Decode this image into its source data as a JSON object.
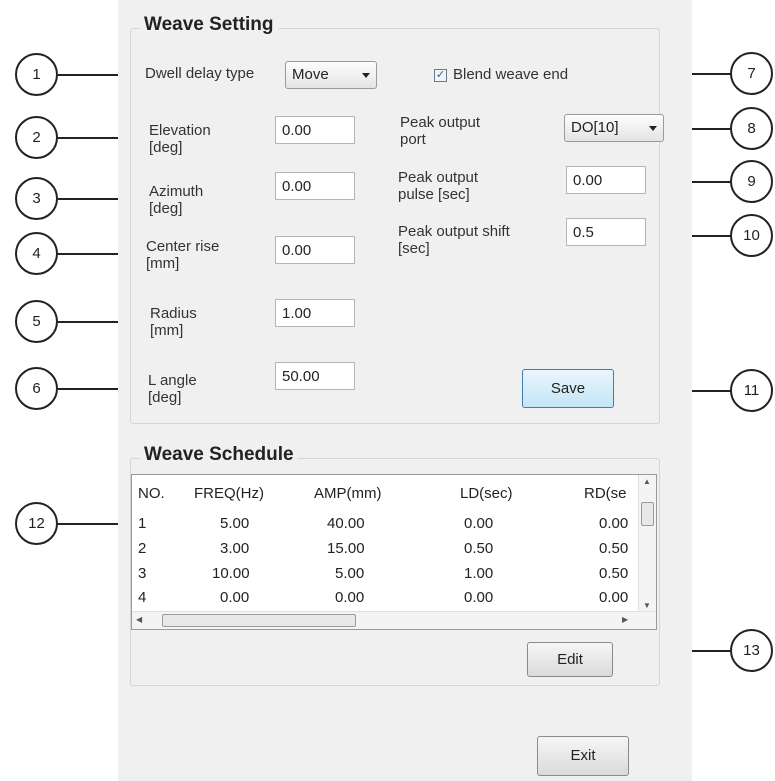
{
  "weave_setting": {
    "title": "Weave Setting",
    "dwell_delay_type": {
      "label": "Dwell delay type",
      "value": "Move"
    },
    "elevation": {
      "label": "Elevation [deg]",
      "value": "0.00"
    },
    "azimuth": {
      "label": "Azimuth [deg]",
      "value": "0.00"
    },
    "center_rise": {
      "label": "Center rise [mm]",
      "value": "0.00"
    },
    "radius": {
      "label": "Radius [mm]",
      "value": "1.00"
    },
    "l_angle": {
      "label": "L angle [deg]",
      "value": "50.00"
    },
    "blend_weave_end": {
      "label": "Blend weave end",
      "checked": true
    },
    "peak_output_port": {
      "label": "Peak output port",
      "value": "DO[10]"
    },
    "peak_output_pulse": {
      "label": "Peak output pulse [sec]",
      "value": "0.00"
    },
    "peak_output_shift": {
      "label": "Peak output shift [sec]",
      "value": "0.5"
    },
    "save_label": "Save"
  },
  "weave_schedule": {
    "title": "Weave Schedule",
    "columns": [
      "NO.",
      "FREQ(Hz)",
      "AMP(mm)",
      "LD(sec)",
      "RD(se"
    ],
    "rows": [
      [
        "1",
        "5.00",
        "40.00",
        "0.00",
        "0.00"
      ],
      [
        "2",
        "3.00",
        "15.00",
        "0.50",
        "0.50"
      ],
      [
        "3",
        "10.00",
        "5.00",
        "1.00",
        "0.50"
      ],
      [
        "4",
        "0.00",
        "0.00",
        "0.00",
        "0.00"
      ]
    ],
    "edit_label": "Edit"
  },
  "exit_label": "Exit",
  "callouts": [
    "1",
    "2",
    "3",
    "4",
    "5",
    "6",
    "7",
    "8",
    "9",
    "10",
    "11",
    "12",
    "13"
  ]
}
